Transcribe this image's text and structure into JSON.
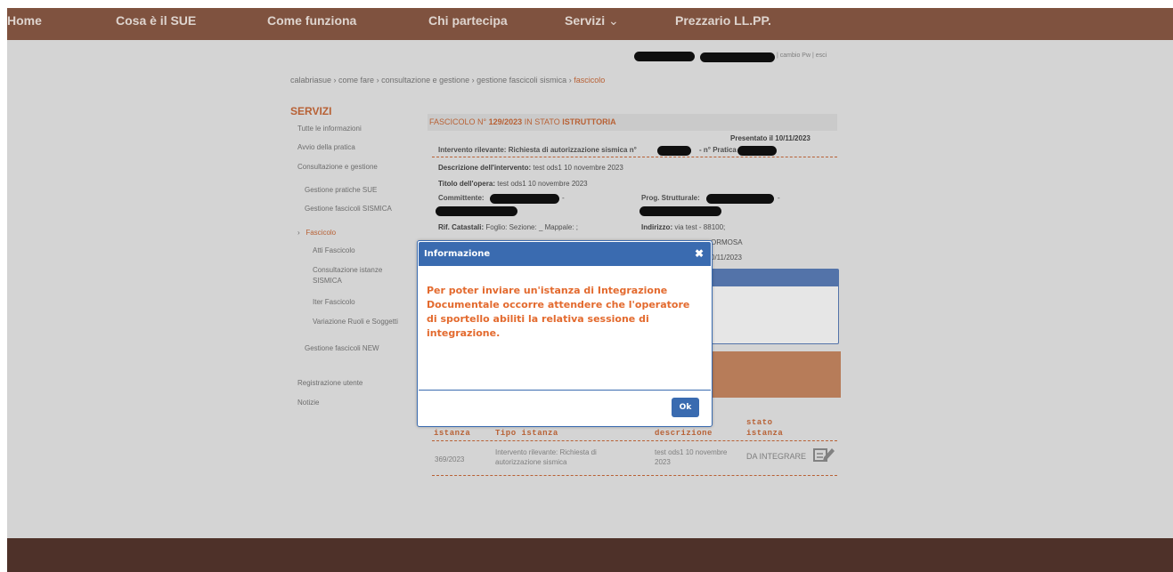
{
  "nav": {
    "home": "Home",
    "cosa": "Cosa è il SUE",
    "come": "Come funziona",
    "chi": "Chi partecipa",
    "servizi": "Servizi",
    "prezzario": "Prezzario LL.PP."
  },
  "userbar": {
    "cambio_pw": "cambio Pw",
    "esci": "esci"
  },
  "breadcrumb": {
    "calabriasue": "calabriasue",
    "come_fare": "come fare",
    "consultazione": "consultazione e gestione",
    "gestione": "gestione fascicoli sismica",
    "current": "fascicolo"
  },
  "sidebar": {
    "title": "SERVIZI",
    "items": [
      "Tutte le informazioni",
      "Avvio della pratica",
      "Consultazione e gestione",
      "Gestione pratiche SUE",
      "Gestione fascicoli SISMICA",
      "Fascicolo",
      "Atti Fascicolo",
      "Consultazione istanze",
      "SISMICA",
      "Iter Fascicolo",
      "Variazione Ruoli e Soggetti",
      "Gestione fascicoli NEW",
      "Registrazione utente",
      "Notizie"
    ]
  },
  "fascicolo": {
    "prefix": "FASCICOLO N°",
    "number": "129/2023",
    "in_stato": "IN STATO",
    "stato": "ISTRUTTORIA",
    "presentato": "Presentato il 10/11/2023",
    "intervento_label": "Intervento rilevante: Richiesta di autorizzazione sismica n°",
    "pratica_label": "- n° Pratica",
    "descrizione_label": "Descrizione dell'intervento:",
    "descrizione": "test ods1 10 novembre 2023",
    "titolo_label": "Titolo dell'opera:",
    "titolo": "test ods1 10 novembre 2023",
    "committente_label": "Committente:",
    "prog_label": "Prog. Strutturale:",
    "rif_label": "Rif. Catastali:",
    "rif": "Foglio: Sezione: _ Mappale: ;",
    "indirizzo_label": "Indirizzo:",
    "indirizzo": "via test - 88100;",
    "comune_partial": "ORMOSA",
    "data_partial": "0/11/2023"
  },
  "table": {
    "headers": [
      "istanza",
      "Tipo istanza",
      "descrizione",
      "stato",
      "istanza"
    ],
    "row": {
      "istanza": "369/2023",
      "tipo_line1": "Intervento rilevante: Richiesta di",
      "tipo_line2": "autorizzazione sismica",
      "descr_line1": "test ods1 10 novembre",
      "descr_line2": "2023",
      "stato": "DA INTEGRARE"
    }
  },
  "dialog": {
    "title": "Informazione",
    "message": "Per poter inviare un'istanza di Integrazione Documentale occorre attendere che l'operatore di sportello abiliti la relativa sessione di integrazione.",
    "ok": "Ok"
  },
  "colors": {
    "nav_bg": "#8a5a45",
    "footer_bg": "#4e3129",
    "accent": "#c86a3a",
    "dialog_blue": "#3a6bb0",
    "message": "#e36a2e"
  }
}
